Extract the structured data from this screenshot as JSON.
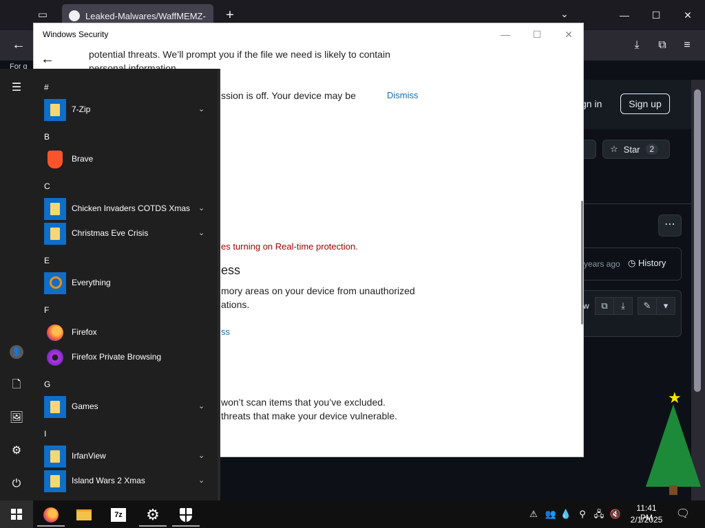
{
  "browser": {
    "tab_title": "Leaked-Malwares/WaffMEMZ-",
    "new_tab_icon": "plus-icon",
    "clipped_text": "For q",
    "github": {
      "signin": "gn in",
      "signup": "Sign up",
      "star_label": "Star",
      "star_count": "2",
      "commit_ago": "years ago",
      "history_label": "History",
      "raw_fragment": "w"
    }
  },
  "security": {
    "window_title": "Windows Security",
    "line1": "potential threats.  We’ll prompt you if the file we need is likely to contain",
    "line2": "personal information.",
    "line3": "ssion is off. Your device may be",
    "dismiss1": "Dismiss",
    "warning": "es turning on Real-time protection.",
    "heading": "ess",
    "body1": "mory areas on your device from unauthorized",
    "body2": "ations.",
    "dismiss2": "ss",
    "body3": "won’t scan items that you’ve excluded.",
    "body4": " threats that make your device vulnerable."
  },
  "start_menu": {
    "sections": [
      {
        "letter": "#",
        "apps": [
          {
            "name": "7-Zip",
            "icon": "folder",
            "expandable": true
          }
        ]
      },
      {
        "letter": "B",
        "apps": [
          {
            "name": "Brave",
            "icon": "brave",
            "expandable": false
          }
        ]
      },
      {
        "letter": "C",
        "apps": [
          {
            "name": "Chicken Invaders COTDS Xmas",
            "icon": "folder",
            "expandable": true
          },
          {
            "name": "Christmas Eve Crisis",
            "icon": "folder",
            "expandable": true
          }
        ]
      },
      {
        "letter": "E",
        "apps": [
          {
            "name": "Everything",
            "icon": "everything",
            "expandable": false
          }
        ]
      },
      {
        "letter": "F",
        "apps": [
          {
            "name": "Firefox",
            "icon": "firefox",
            "expandable": false
          },
          {
            "name": "Firefox Private Browsing",
            "icon": "ffpriv",
            "expandable": false
          }
        ]
      },
      {
        "letter": "G",
        "apps": [
          {
            "name": "Games",
            "icon": "folder",
            "expandable": true
          }
        ]
      },
      {
        "letter": "I",
        "apps": [
          {
            "name": "IrfanView",
            "icon": "folder",
            "expandable": true
          },
          {
            "name": "Island Wars 2 Xmas",
            "icon": "folder",
            "expandable": true
          }
        ]
      }
    ]
  },
  "taskbar": {
    "apps": [
      "firefox",
      "file-explorer",
      "7-zip",
      "settings",
      "windows-security"
    ],
    "seven_zip_label": "7z",
    "time": "11:41 PM",
    "date": "2/1/2025"
  },
  "colors": {
    "accent": "#0f6ec7",
    "link": "#1a6ba8",
    "warning": "#a80000",
    "start_bg": "#1f1f1f",
    "github_bg": "#0d1117"
  }
}
